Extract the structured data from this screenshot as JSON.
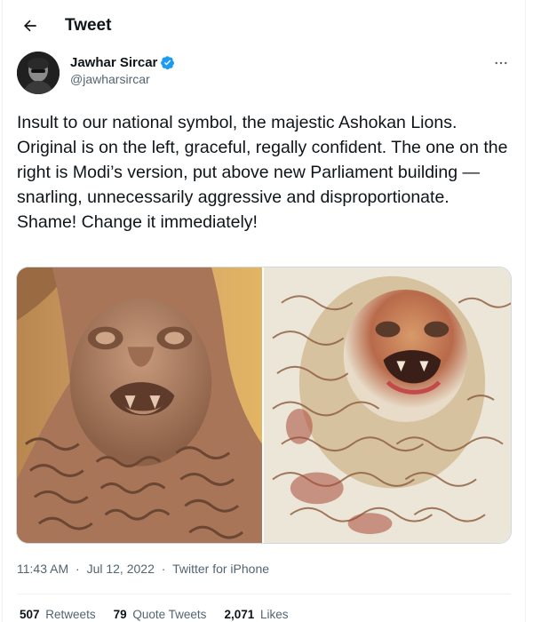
{
  "header": {
    "title": "Tweet"
  },
  "author": {
    "display_name": "Jawhar Sircar",
    "handle": "@jawharsircar",
    "verified": true
  },
  "tweet": {
    "text": "Insult to our national symbol, the majestic Ashokan Lions.  Original is on the left, graceful, regally confident. The one on the right is Modi’s version, put above new Parliament building — snarling, unnecessarily aggressive and disproportionate. Shame! Change it immediately!",
    "time": "11:43 AM",
    "date": "Jul 12, 2022",
    "source": "Twitter for iPhone"
  },
  "stats": {
    "retweets_count": "507",
    "retweets_label": "Retweets",
    "quotes_count": "79",
    "quotes_label": "Quote Tweets",
    "likes_count": "2,071",
    "likes_label": "Likes"
  },
  "colors": {
    "accent": "#1d9bf0",
    "text": "#0f1419",
    "muted": "#536471"
  },
  "icons": {
    "back": "arrow-left-icon",
    "verified": "verified-badge-icon",
    "more": "more-options-icon"
  }
}
